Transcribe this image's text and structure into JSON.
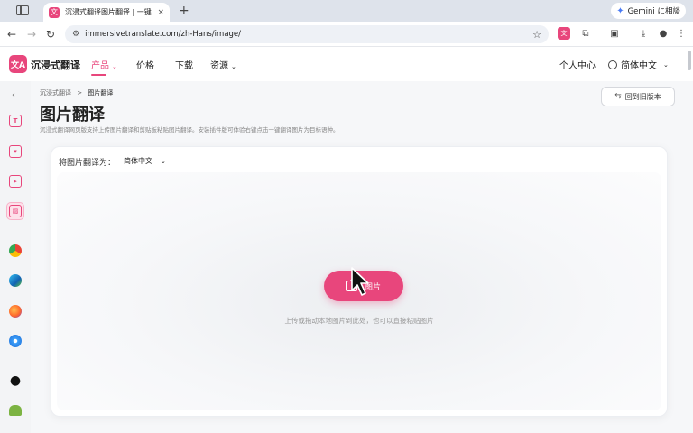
{
  "browser": {
    "tab_title": "沉浸式翻译图片翻译 | 一键OCR",
    "tab_close": "×",
    "new_tab": "+",
    "gemini_label": "Gemini に相談",
    "url": "immersivetranslate.com/zh-Hans/image/",
    "favicon_text": "文"
  },
  "header": {
    "logo_text": "文A",
    "brand": "沉浸式翻译",
    "nav": [
      {
        "label": "产品",
        "active": true,
        "dropdown": true
      },
      {
        "label": "价格",
        "active": false,
        "dropdown": false
      },
      {
        "label": "下载",
        "active": false,
        "dropdown": false
      },
      {
        "label": "资源",
        "active": false,
        "dropdown": true
      }
    ],
    "user_center": "个人中心",
    "language": "简体中文"
  },
  "rail": {
    "collapse": "‹",
    "items": [
      {
        "name": "text-translate-icon",
        "label": "T",
        "active": false
      },
      {
        "name": "video-translate-icon",
        "label": "",
        "active": false
      },
      {
        "name": "subtitle-icon",
        "label": "",
        "active": false
      },
      {
        "name": "image-translate-icon",
        "label": "",
        "active": true
      },
      {
        "name": "chrome-icon",
        "label": "",
        "active": false
      },
      {
        "name": "edge-icon",
        "label": "",
        "active": false
      },
      {
        "name": "firefox-icon",
        "label": "",
        "active": false
      },
      {
        "name": "safari-icon",
        "label": "",
        "active": false
      },
      {
        "name": "apple-icon",
        "label": "",
        "active": false
      },
      {
        "name": "android-icon",
        "label": "",
        "active": false
      }
    ]
  },
  "main": {
    "breadcrumb_root": "沉浸式翻译",
    "breadcrumb_sep": ">",
    "breadcrumb_current": "图片翻译",
    "title": "图片翻译",
    "description": "沉浸式翻译网页版支持上传图片翻译和剪贴板粘贴图片翻译。安装插件版可体验右键点击一键翻译图片为目标语种。",
    "back_button": "回到旧版本",
    "translate_to_label": "将图片翻译为：",
    "target_language": "简体中文",
    "upload_button": "图片",
    "upload_hint": "上传或拖动本地图片到此处，也可以直接粘贴图片"
  },
  "colors": {
    "accent": "#e8467c"
  }
}
